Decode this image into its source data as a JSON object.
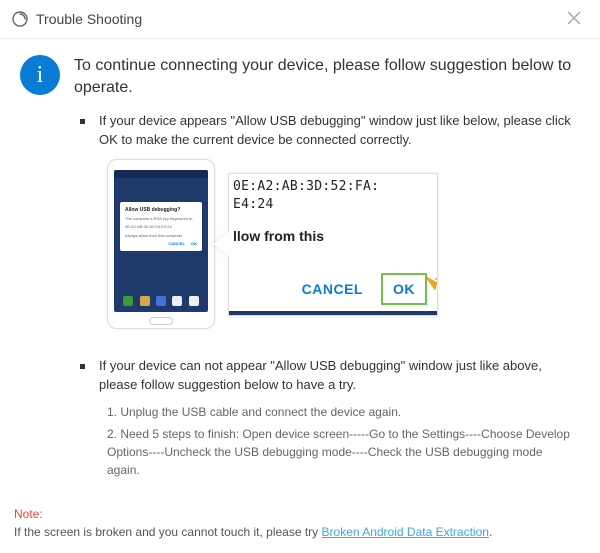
{
  "titlebar": {
    "title": "Trouble Shooting"
  },
  "heading": "To continue connecting your device, please follow suggestion below to operate.",
  "item1": "If your device appears \"Allow USB debugging\" window just like below, please click OK to make the current device  be connected correctly.",
  "phoneDialog": {
    "title": "Allow USB debugging?",
    "body1": "The computer's RSA key fingerprint is:",
    "body2": "0E:A2:AB:3D:52:FA:E4:24",
    "check": "Always allow from this computer",
    "cancel": "CANCEL",
    "ok": "OK"
  },
  "closeup": {
    "line1": "0E:A2:AB:3D:52:FA:",
    "line2": "E4:24",
    "mid": "llow from this",
    "cancel": "CANCEL",
    "ok": "OK"
  },
  "item2": "If your device can not appear \"Allow USB debugging\" window just like above, please follow suggestion below to have a try.",
  "step1": "1. Unplug the USB cable and connect the device again.",
  "step2": "2. Need 5 steps to finish: Open device screen-----Go to the Settings----Choose Develop Options----Uncheck the USB debugging mode----Check the USB debugging mode again.",
  "note": {
    "label": "Note:",
    "text": "If the screen is broken and you cannot touch it, please try ",
    "link": "Broken Android Data Extraction",
    "suffix": "."
  }
}
